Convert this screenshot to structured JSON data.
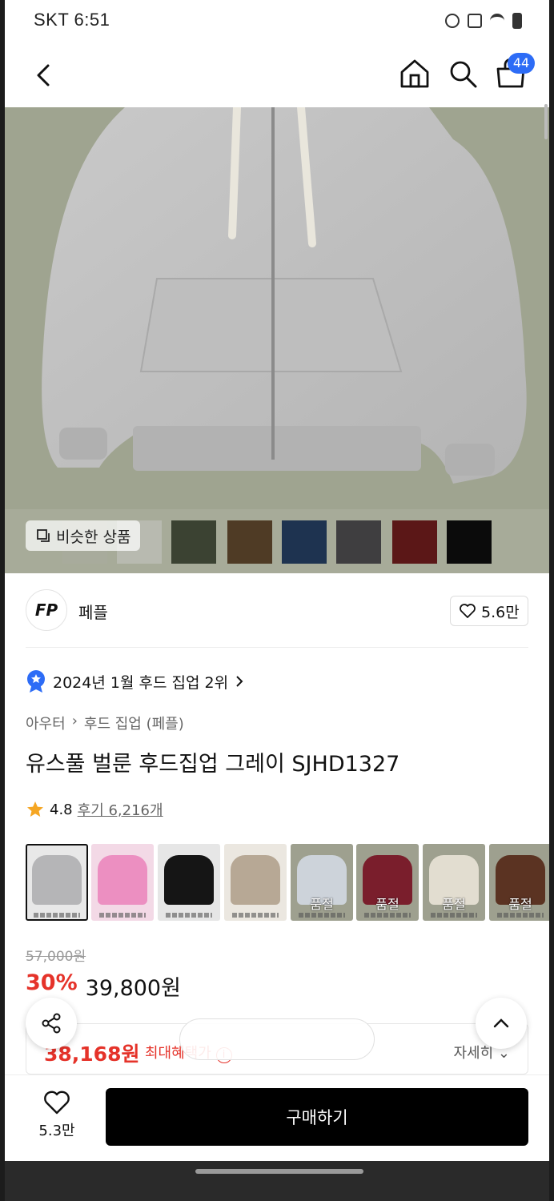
{
  "status_bar": {
    "time": "SKT 6:51"
  },
  "header": {
    "cart_count": "44"
  },
  "gallery": {
    "similar_label": "비슷한 상품",
    "swatch_colors": [
      "#a8ab9c",
      "#b8bab0",
      "#3b4232",
      "#4f3b25",
      "#1e3350",
      "#3f3e40",
      "#5b1717",
      "#0b0b0b"
    ]
  },
  "brand": {
    "logo_text": "FP",
    "name": "페플",
    "likes": "5.6만"
  },
  "ranking": {
    "text": "2024년 1월 후드 집업 2위"
  },
  "breadcrumb": [
    "아우터",
    "후드 집업 (페플)"
  ],
  "product": {
    "title": "유스풀 벌룬 후드집업 그레이 SJHD1327",
    "rating": "4.8",
    "reviews": "후기 6,216개"
  },
  "variants": [
    {
      "color": "#b5b5b7",
      "bg": "#e8e8e8",
      "sold_out": ""
    },
    {
      "color": "#ec8fc1",
      "bg": "#f3d9e6",
      "sold_out": ""
    },
    {
      "color": "#151515",
      "bg": "#e6e6e6",
      "sold_out": ""
    },
    {
      "color": "#b7a895",
      "bg": "#ebe7e0",
      "sold_out": ""
    },
    {
      "color": "#cdd3da",
      "bg": "#9ea08f",
      "sold_out": "품절"
    },
    {
      "color": "#7a1e2c",
      "bg": "#9ea08f",
      "sold_out": "품절"
    },
    {
      "color": "#e2ddd0",
      "bg": "#9ea08f",
      "sold_out": "품절"
    },
    {
      "color": "#5b3322",
      "bg": "#9ea08f",
      "sold_out": "품절"
    }
  ],
  "pricing": {
    "original": "57,000원",
    "discount": "30%",
    "price": "39,800원",
    "benefit_price": "38,168원",
    "benefit_label": "최대혜택가",
    "details": "자세히"
  },
  "bottom": {
    "wish_count": "5.3만",
    "buy_label": "구매하기"
  }
}
